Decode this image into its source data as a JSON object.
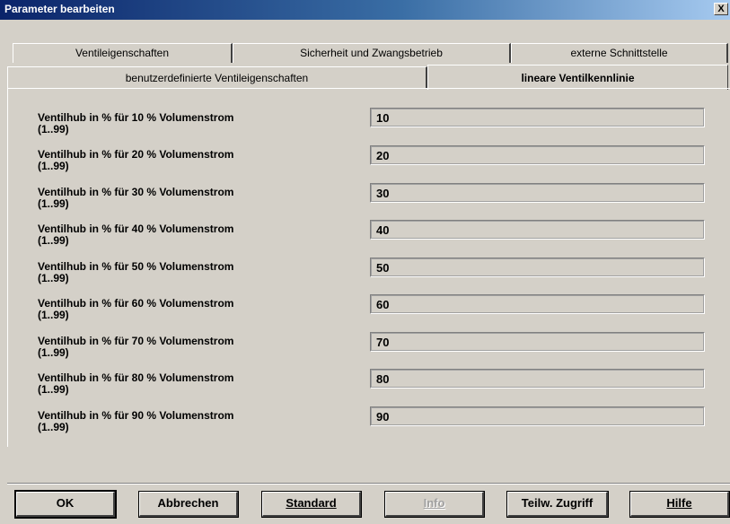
{
  "window": {
    "title": "Parameter bearbeiten",
    "close_glyph": "X"
  },
  "tabs_row1": [
    {
      "label": "Ventileigenschaften"
    },
    {
      "label": "Sicherheit und Zwangsbetrieb"
    },
    {
      "label": "externe Schnittstelle"
    }
  ],
  "tabs_row2": [
    {
      "label": "benutzerdefinierte Ventileigenschaften"
    },
    {
      "label": "lineare Ventilkennlinie",
      "active": true
    }
  ],
  "rows": [
    {
      "label": "Ventilhub in % für 10 %  Volumenstrom",
      "range": "(1..99)",
      "value": "10"
    },
    {
      "label": "Ventilhub in % für 20 %  Volumenstrom",
      "range": "(1..99)",
      "value": "20"
    },
    {
      "label": "Ventilhub in % für 30 %  Volumenstrom",
      "range": "(1..99)",
      "value": "30"
    },
    {
      "label": "Ventilhub in % für 40 %  Volumenstrom",
      "range": "(1..99)",
      "value": "40"
    },
    {
      "label": "Ventilhub in % für 50 %  Volumenstrom",
      "range": "(1..99)",
      "value": "50"
    },
    {
      "label": "Ventilhub in % für 60 %  Volumenstrom",
      "range": "(1..99)",
      "value": "60"
    },
    {
      "label": "Ventilhub in % für 70 %  Volumenstrom",
      "range": "(1..99)",
      "value": "70"
    },
    {
      "label": "Ventilhub in % für 80 %  Volumenstrom",
      "range": "(1..99)",
      "value": "80"
    },
    {
      "label": "Ventilhub in % für 90 %  Volumenstrom",
      "range": "(1..99)",
      "value": "90"
    }
  ],
  "buttons": {
    "ok": "OK",
    "cancel": "Abbrechen",
    "standard": "Standard",
    "info": "Info",
    "partial_access": "Teilw. Zugriff",
    "help": "Hilfe"
  }
}
